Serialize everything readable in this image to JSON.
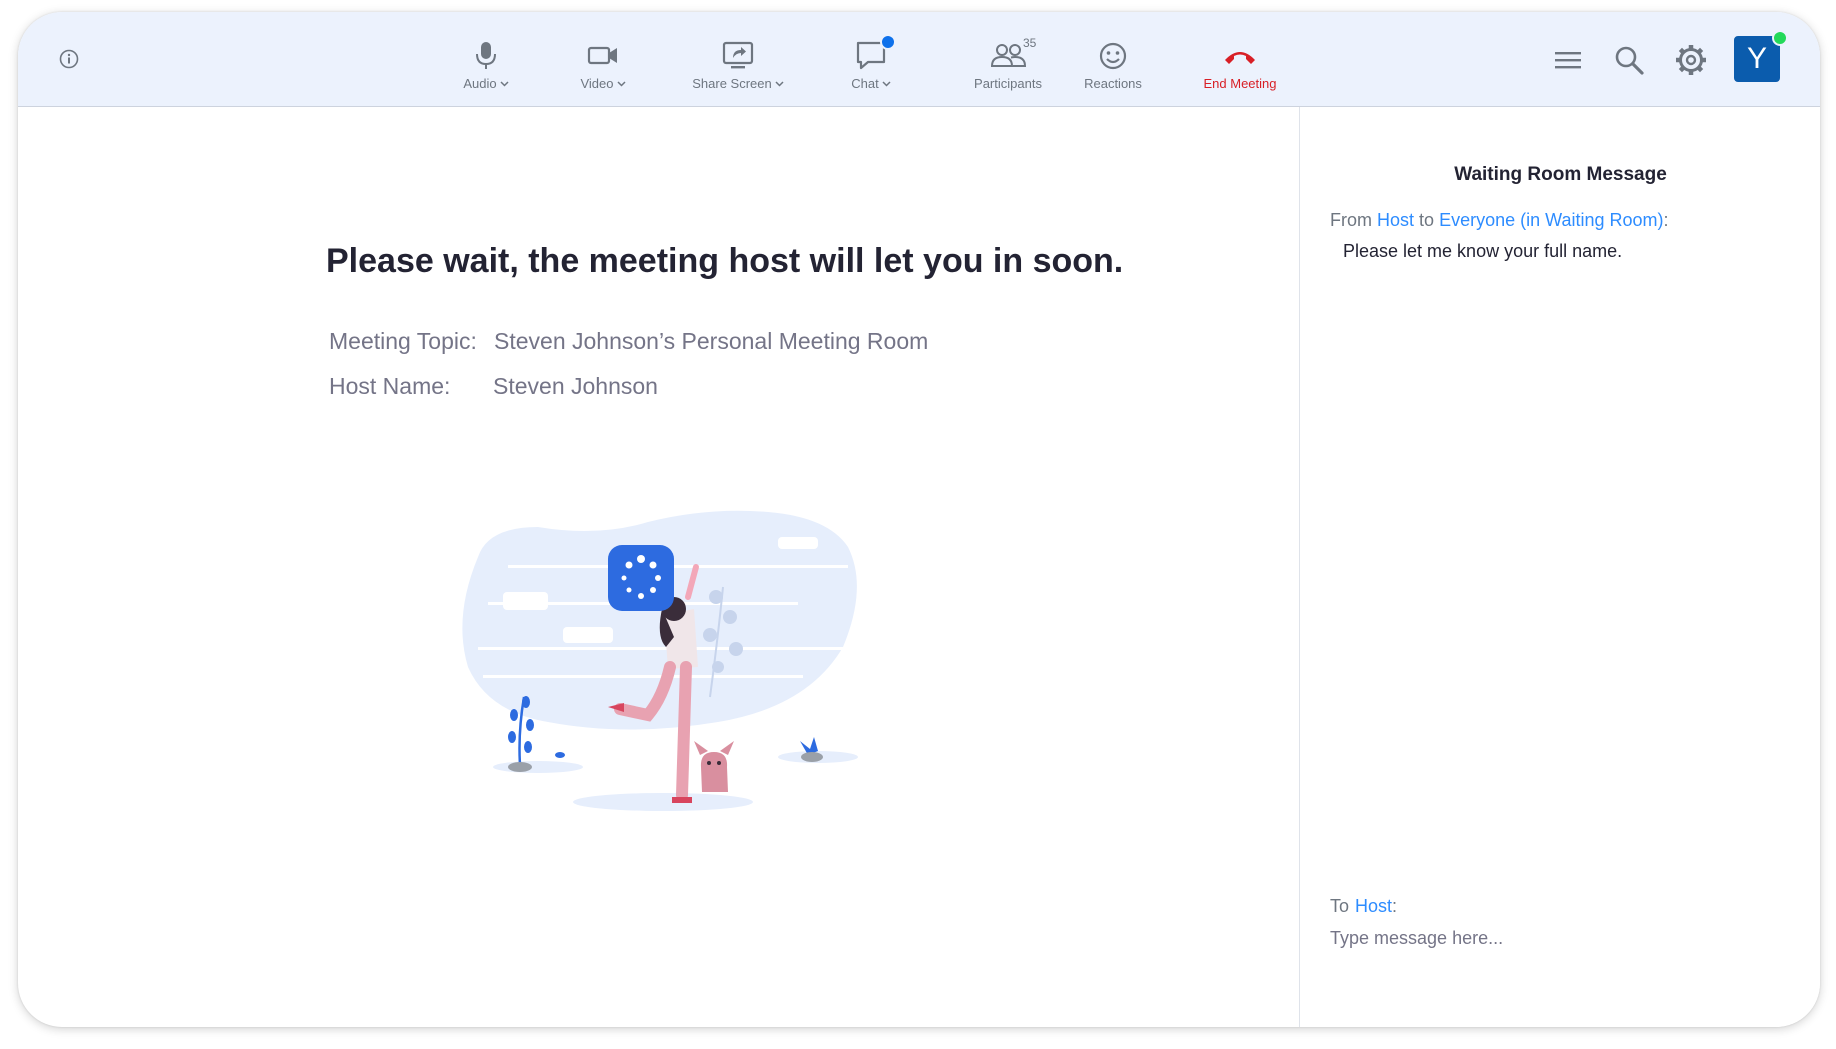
{
  "toolbar": {
    "audio_label": "Audio",
    "video_label": "Video",
    "share_label": "Share Screen",
    "chat_label": "Chat",
    "participants_label": "Participants",
    "participants_count": "35",
    "reactions_label": "Reactions",
    "end_label": "End Meeting",
    "avatar_initial": "Y"
  },
  "main": {
    "headline": "Please wait, the meeting host will let you in soon.",
    "topic_label": "Meeting Topic:",
    "topic_value": "Steven Johnson’s Personal Meeting Room",
    "host_label": "Host Name:",
    "host_value": "Steven Johnson"
  },
  "panel": {
    "title": "Waiting Room Message",
    "from_prefix": "From",
    "from_sender": "Host",
    "from_to": "to",
    "from_recipient": "Everyone (in Waiting Room)",
    "from_suffix": ":",
    "message": "Please let me know your full name.",
    "to_prefix": "To",
    "to_recipient": "Host",
    "to_suffix": ":",
    "input_placeholder": "Type message here..."
  },
  "colors": {
    "toolbar_bg": "#ecf2fd",
    "accent": "#2d8cff",
    "end_red": "#d81f26",
    "avatar_bg": "#0b5cad",
    "presence_green": "#23d959"
  },
  "icons": [
    "info-icon",
    "microphone-icon",
    "video-camera-icon",
    "share-screen-icon",
    "chat-icon",
    "participants-icon",
    "reactions-icon",
    "end-call-icon",
    "menu-icon",
    "search-icon",
    "gear-icon"
  ]
}
